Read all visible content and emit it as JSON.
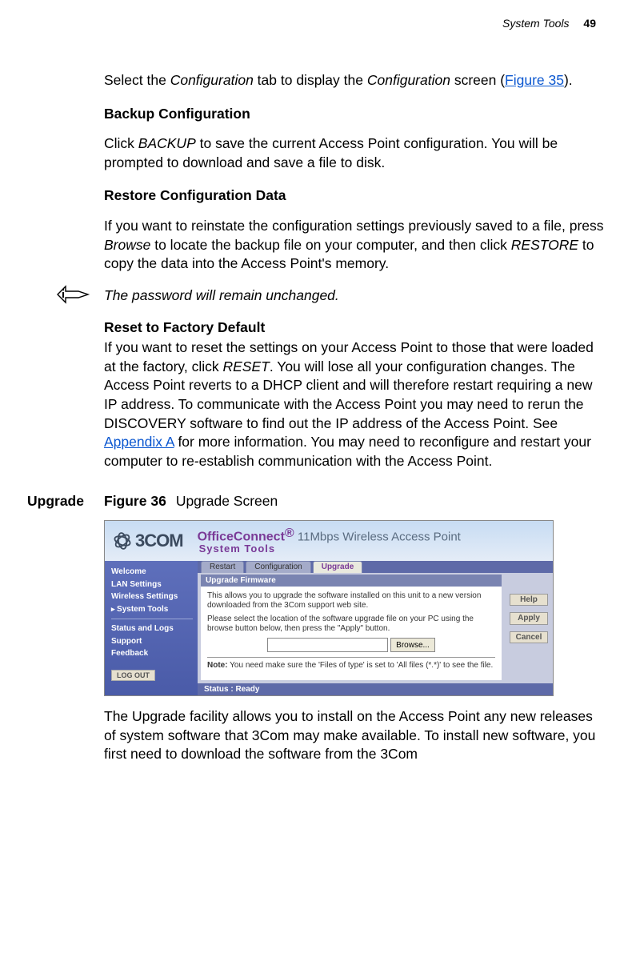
{
  "header": {
    "section": "System Tools",
    "page_number": "49"
  },
  "body": {
    "intro_part1": "Select the ",
    "intro_conf1": "Configuration",
    "intro_part2": " tab to display the ",
    "intro_conf2": "Configuration",
    "intro_part3": " screen (",
    "intro_link": "Figure 35",
    "intro_part4": ").",
    "h_backup": "Backup Configuration",
    "backup_p1": "Click ",
    "backup_ital": "BACKUP",
    "backup_p2": " to save the current Access Point configuration. You will be prompted to download and save a file to disk.",
    "h_restore": "Restore Configuration Data",
    "restore_p1": "If you want to reinstate the configuration settings previously saved to a file, press ",
    "restore_ital1": "Browse",
    "restore_p2": " to locate the backup file on your computer, and then click ",
    "restore_ital2": "RESTORE",
    "restore_p3": " to copy the data into the Access Point's memory.",
    "note_text": "The password will remain unchanged.",
    "h_reset": "Reset to Factory Default",
    "reset_p1": "If you want to reset the settings on your Access Point to those that were loaded at the factory, click ",
    "reset_ital": "RESET",
    "reset_p2": ". You will lose all your configuration changes. The Access Point reverts to a DHCP client and will therefore restart requiring a new IP address. To communicate with the Access Point you may need to rerun the DISCOVERY software to find out the IP address of the Access Point. See ",
    "reset_link": "Appendix A",
    "reset_p3": " for more information. You may need to reconfigure and restart your computer to re-establish communication with the Access Point.",
    "side_label": "Upgrade",
    "fig_num": "Figure 36",
    "fig_caption": "Upgrade Screen",
    "final_para": "The Upgrade facility allows you to install on the Access Point any new releases of system software that 3Com may make available. To install new software, you first need to download the software from the 3Com"
  },
  "screenshot": {
    "logo_text": "3COM",
    "brand_office": "OfficeConnect",
    "brand_reg": "®",
    "brand_rest": " 11Mbps Wireless Access Point",
    "brand_sub": "System Tools",
    "sidebar": {
      "items": [
        "Welcome",
        "LAN Settings",
        "Wireless Settings",
        "System Tools",
        "Status and Logs",
        "Support",
        "Feedback"
      ],
      "selected_index": 3,
      "logout": "LOG OUT"
    },
    "tabs": {
      "items": [
        "Restart",
        "Configuration",
        "Upgrade"
      ],
      "active_index": 2
    },
    "panel_title": "Upgrade Firmware",
    "panel_p1": "This allows you to upgrade the software installed on this unit to a new version downloaded from the 3Com support web site.",
    "panel_p2": "Please select the location of the software upgrade file on your PC using the browse button below, then press the \"Apply\" button.",
    "browse_label": "Browse...",
    "panel_note_lead": "Note:",
    "panel_note_rest": " You need make sure the 'Files of type' is set to 'All files (*.*)' to see the file.",
    "right_buttons": [
      "Help",
      "Apply",
      "Cancel"
    ],
    "status": "Status : Ready"
  }
}
